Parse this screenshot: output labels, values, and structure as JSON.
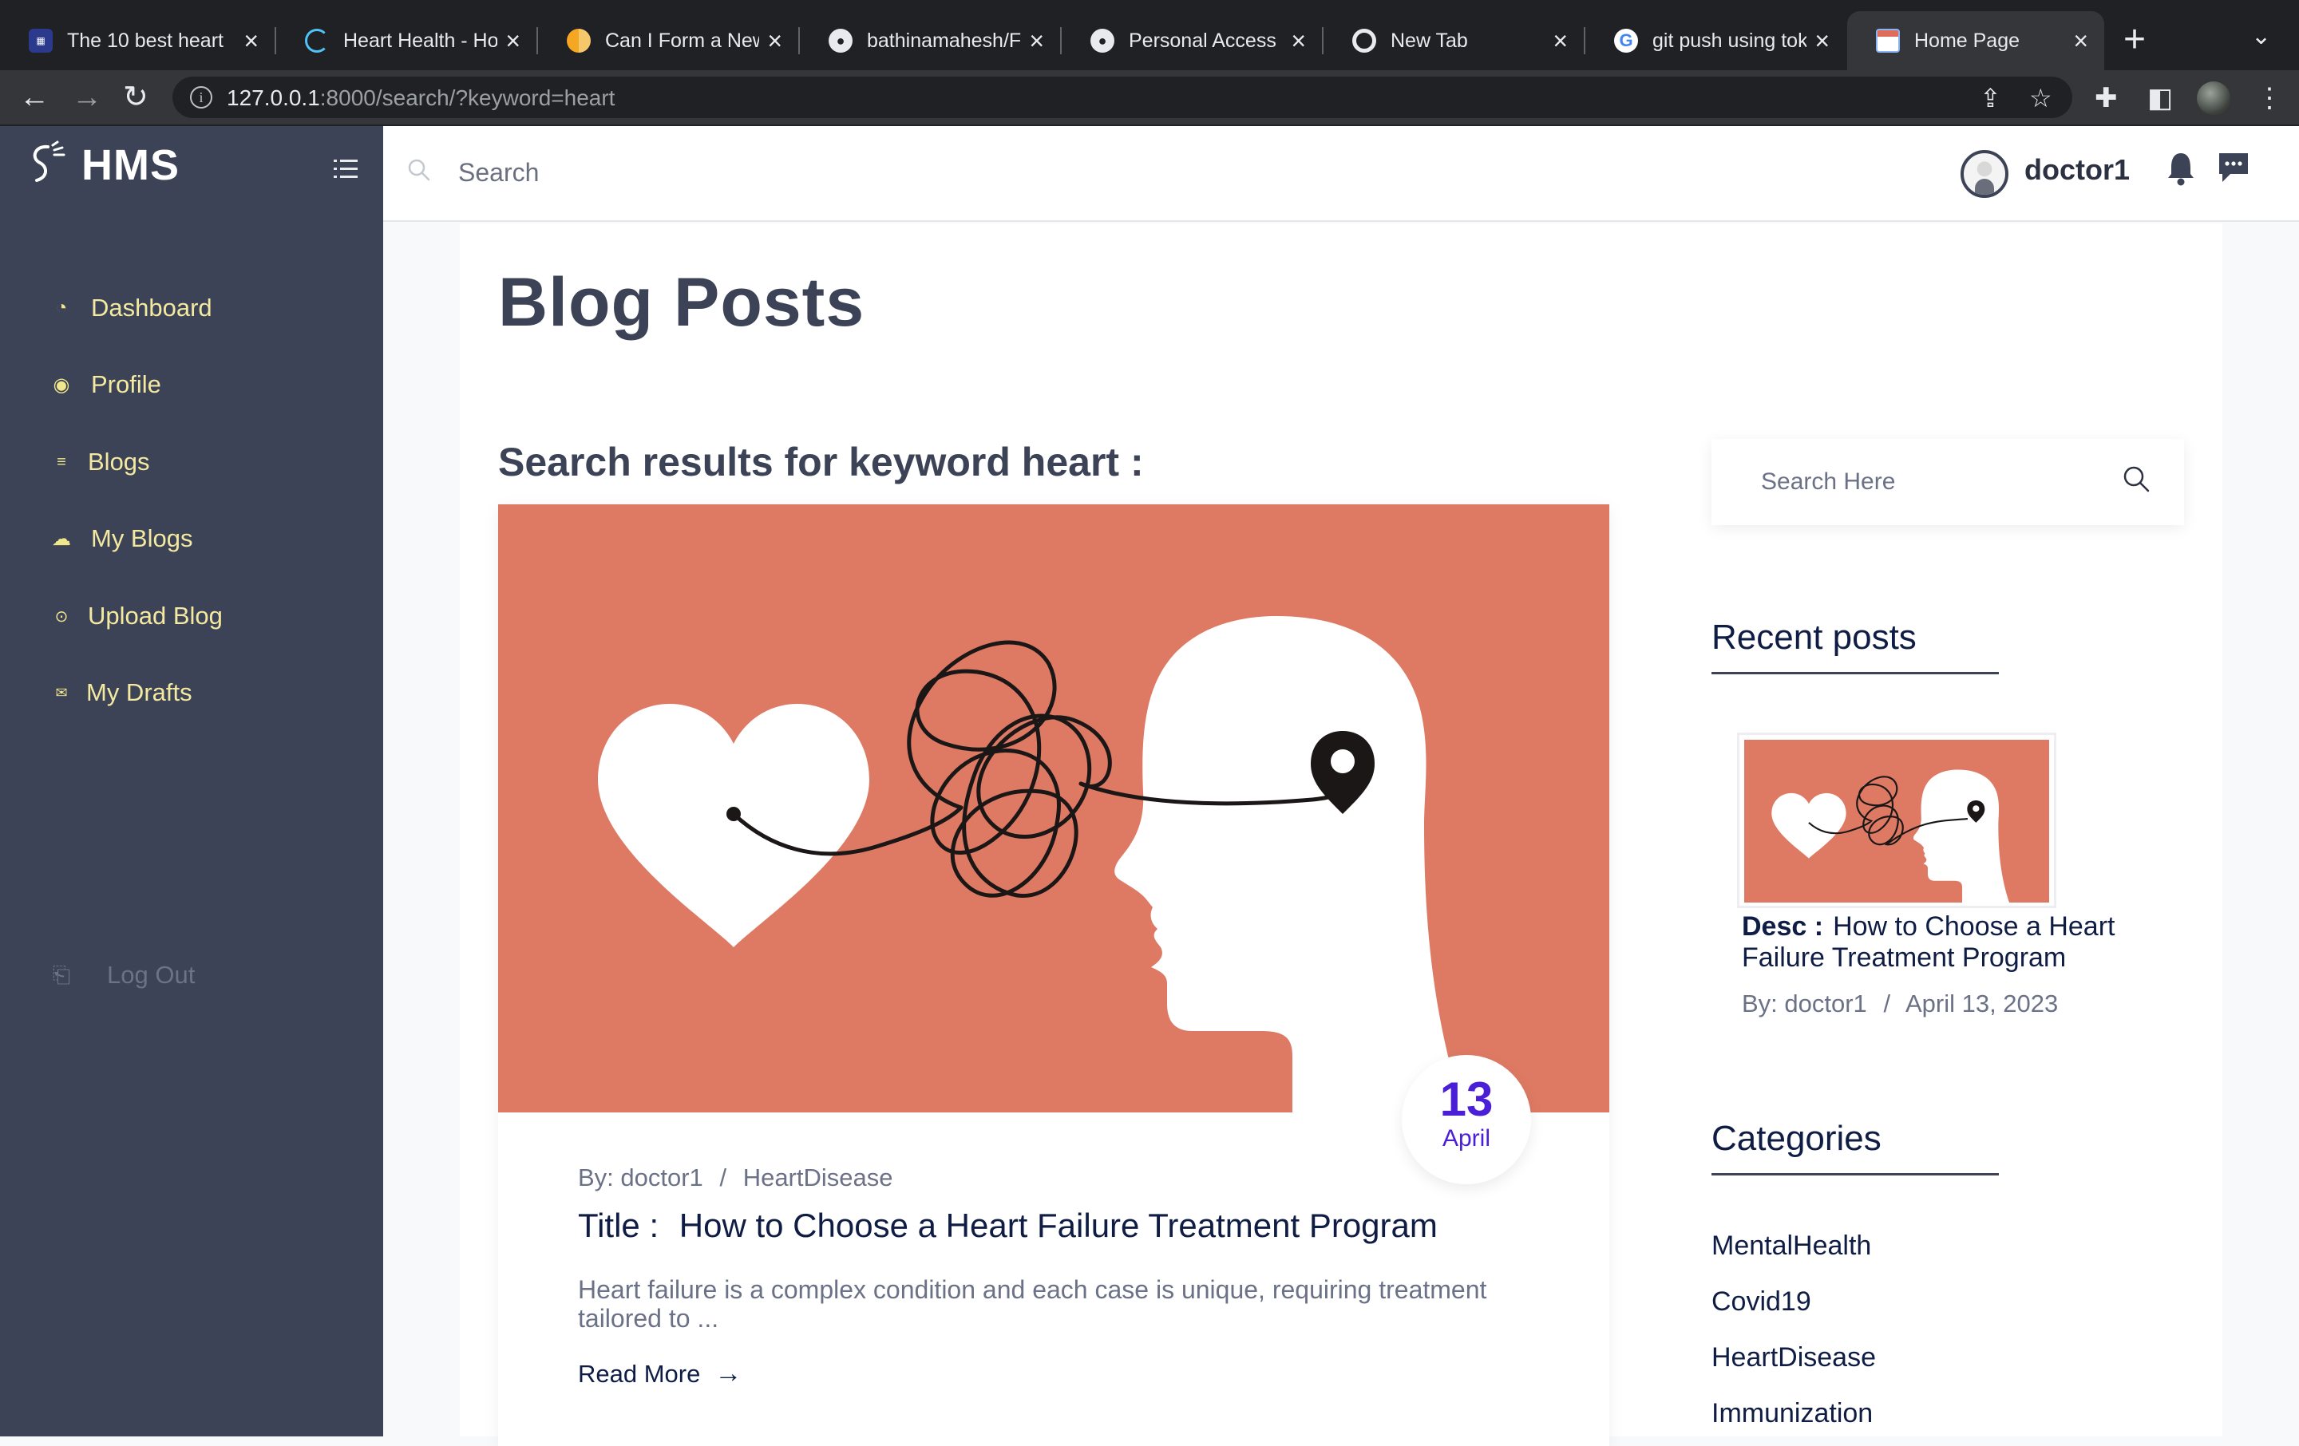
{
  "browser": {
    "tabs": [
      {
        "title": "The 10 best heart",
        "favicon": "blog-favicon",
        "active": false
      },
      {
        "title": "Heart Health - Ho",
        "favicon": "spinner-favicon",
        "active": false
      },
      {
        "title": "Can I Form a New",
        "favicon": "orange-favicon",
        "active": false
      },
      {
        "title": "bathinamahesh/Fi",
        "favicon": "github-favicon",
        "active": false
      },
      {
        "title": "Personal Access",
        "favicon": "github-favicon",
        "active": false
      },
      {
        "title": "New Tab",
        "favicon": "chrome-favicon",
        "active": false
      },
      {
        "title": "git push using tok",
        "favicon": "google-favicon",
        "active": false
      },
      {
        "title": "Home Page",
        "favicon": "calendar-favicon",
        "active": true
      }
    ],
    "url_host": "127.0.0.1",
    "url_rest": ":8000/search/?keyword=heart"
  },
  "sidebar": {
    "brand": "HMS",
    "items": [
      {
        "label": "Dashboard",
        "icon": "gauge-icon"
      },
      {
        "label": "Profile",
        "icon": "user-circle-icon"
      },
      {
        "label": "Blogs",
        "icon": "list-icon"
      },
      {
        "label": "My Blogs",
        "icon": "cloud-icon"
      },
      {
        "label": "Upload Blog",
        "icon": "upload-icon"
      },
      {
        "label": "My Drafts",
        "icon": "drafts-icon"
      }
    ],
    "logout_label": "Log Out"
  },
  "header": {
    "search_placeholder": "Search",
    "username": "doctor1"
  },
  "main": {
    "page_title": "Blog Posts",
    "results_heading": "Search results for keyword heart :",
    "post": {
      "date_day": "13",
      "date_month": "April",
      "author": "By: doctor1",
      "meta_separator": "/",
      "category": "HeartDisease",
      "title_label": "Title :",
      "title": "How to Choose a Heart Failure Treatment Program",
      "excerpt": "Heart failure is a complex condition and each case is unique, requiring treatment tailored to ...",
      "read_more": "Read More"
    }
  },
  "widgets": {
    "search_placeholder": "Search Here",
    "recent_posts_title": "Recent posts",
    "recent_post": {
      "desc_label": "Desc :",
      "desc": "How to Choose a Heart Failure Treatment Program",
      "author": "By: doctor1",
      "separator": "/",
      "date": "April 13, 2023"
    },
    "categories_title": "Categories",
    "categories": [
      "MentalHealth",
      "Covid19",
      "HeartDisease",
      "Immunization"
    ]
  },
  "colors": {
    "sidebar_bg": "#3d4356",
    "sidebar_text": "#f3e9a0",
    "accent_purple": "#4b1fd6",
    "image_bg": "#de7a64",
    "title_navy": "#0f1d45"
  }
}
